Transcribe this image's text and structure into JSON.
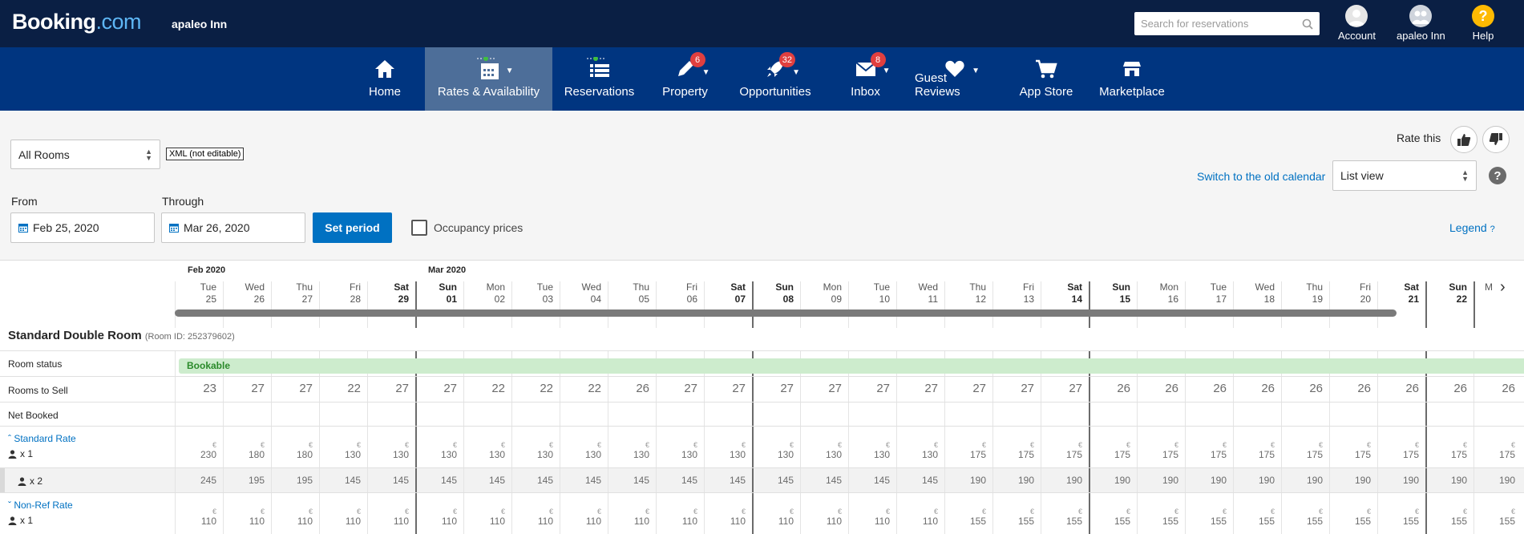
{
  "header": {
    "logo_main": "Booking",
    "logo_suffix": ".com",
    "property_name": "apaleo Inn",
    "search_placeholder": "Search for reservations",
    "account_label": "Account",
    "user_label": "apaleo Inn",
    "help_label": "Help"
  },
  "nav": [
    {
      "label": "Home",
      "icon": "home-icon",
      "badge": ""
    },
    {
      "label": "Rates & Availability",
      "icon": "calendar-icon",
      "badge": "",
      "active": true
    },
    {
      "label": "Reservations",
      "icon": "list-icon",
      "badge": ""
    },
    {
      "label": "Property",
      "icon": "pencil-icon",
      "badge": "6"
    },
    {
      "label": "Opportunities",
      "icon": "rocket-icon",
      "badge": "32"
    },
    {
      "label": "Inbox",
      "icon": "envelope-icon",
      "badge": "8"
    },
    {
      "label": "Guest Reviews",
      "icon": "heart-icon",
      "badge": ""
    },
    {
      "label": "App Store",
      "icon": "cart-icon",
      "badge": ""
    },
    {
      "label": "Marketplace",
      "icon": "store-icon",
      "badge": ""
    }
  ],
  "controls": {
    "room_select": "All Rooms",
    "xml_tag": "XML (not editable)",
    "rate_this": "Rate this",
    "old_calendar_link": "Switch to the old calendar",
    "view_select": "List view",
    "from_label": "From",
    "from_value": "Feb 25, 2020",
    "through_label": "Through",
    "through_value": "Mar 26, 2020",
    "set_period": "Set period",
    "occupancy_label": "Occupancy prices",
    "legend_link": "Legend"
  },
  "calendar": {
    "months": [
      {
        "label": "Feb 2020",
        "start_index": 0
      },
      {
        "label": "Mar 2020",
        "start_index": 5
      }
    ],
    "days": [
      {
        "d": "Tue",
        "n": "25"
      },
      {
        "d": "Wed",
        "n": "26"
      },
      {
        "d": "Thu",
        "n": "27"
      },
      {
        "d": "Fri",
        "n": "28"
      },
      {
        "d": "Sat",
        "n": "29"
      },
      {
        "d": "Sun",
        "n": "01"
      },
      {
        "d": "Mon",
        "n": "02"
      },
      {
        "d": "Tue",
        "n": "03"
      },
      {
        "d": "Wed",
        "n": "04"
      },
      {
        "d": "Thu",
        "n": "05"
      },
      {
        "d": "Fri",
        "n": "06"
      },
      {
        "d": "Sat",
        "n": "07"
      },
      {
        "d": "Sun",
        "n": "08"
      },
      {
        "d": "Mon",
        "n": "09"
      },
      {
        "d": "Tue",
        "n": "10"
      },
      {
        "d": "Wed",
        "n": "11"
      },
      {
        "d": "Thu",
        "n": "12"
      },
      {
        "d": "Fri",
        "n": "13"
      },
      {
        "d": "Sat",
        "n": "14"
      },
      {
        "d": "Sun",
        "n": "15"
      },
      {
        "d": "Mon",
        "n": "16"
      },
      {
        "d": "Tue",
        "n": "17"
      },
      {
        "d": "Wed",
        "n": "18"
      },
      {
        "d": "Thu",
        "n": "19"
      },
      {
        "d": "Fri",
        "n": "20"
      },
      {
        "d": "Sat",
        "n": "21"
      },
      {
        "d": "Sun",
        "n": "22"
      }
    ],
    "next_day_partial": "M"
  },
  "room": {
    "name": "Standard Double Room",
    "room_id": "(Room ID: 252379602)",
    "status_label": "Room status",
    "status_value": "Bookable",
    "rooms_to_sell_label": "Rooms to Sell",
    "rooms_to_sell": [
      "23",
      "27",
      "27",
      "22",
      "27",
      "27",
      "22",
      "22",
      "22",
      "26",
      "27",
      "27",
      "27",
      "27",
      "27",
      "27",
      "27",
      "27",
      "27",
      "26",
      "26",
      "26",
      "26",
      "26",
      "26",
      "26",
      "26",
      "26"
    ],
    "net_booked_label": "Net Booked",
    "currency": "€",
    "rates": [
      {
        "name": "Standard Rate",
        "occupancy": "x 1",
        "prices": [
          "230",
          "180",
          "180",
          "130",
          "130",
          "130",
          "130",
          "130",
          "130",
          "130",
          "130",
          "130",
          "130",
          "130",
          "130",
          "130",
          "175",
          "175",
          "175",
          "175",
          "175",
          "175",
          "175",
          "175",
          "175",
          "175",
          "175",
          "175"
        ]
      },
      {
        "name": "",
        "occupancy": "x 2",
        "prices": [
          "245",
          "195",
          "195",
          "145",
          "145",
          "145",
          "145",
          "145",
          "145",
          "145",
          "145",
          "145",
          "145",
          "145",
          "145",
          "145",
          "190",
          "190",
          "190",
          "190",
          "190",
          "190",
          "190",
          "190",
          "190",
          "190",
          "190",
          "190"
        ]
      },
      {
        "name": "Non-Ref Rate",
        "occupancy": "x 1",
        "prices": [
          "110",
          "110",
          "110",
          "110",
          "110",
          "110",
          "110",
          "110",
          "110",
          "110",
          "110",
          "110",
          "110",
          "110",
          "110",
          "110",
          "155",
          "155",
          "155",
          "155",
          "155",
          "155",
          "155",
          "155",
          "155",
          "155",
          "155",
          "155"
        ]
      }
    ]
  }
}
